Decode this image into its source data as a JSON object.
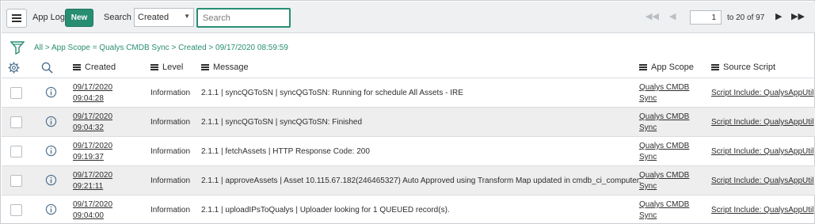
{
  "header": {
    "title": "App Log",
    "new_label": "New",
    "search_label": "Search",
    "search_field": "Created",
    "search_placeholder": "Search",
    "page_value": "1",
    "page_text": "to 20 of 97"
  },
  "breadcrumb": {
    "all": "All",
    "sep1": ">",
    "scope": "App Scope = Qualys CMDB Sync",
    "sep2": ">",
    "created": "Created > 09/17/2020 08:59:59"
  },
  "columns": {
    "created": "Created",
    "level": "Level",
    "message": "Message",
    "app_scope": "App Scope",
    "source_script": "Source Script"
  },
  "rows": [
    {
      "date": "09/17/2020",
      "time": "09:04:28",
      "level": "Information",
      "message": "2.1.1 | syncQGToSN | syncQGToSN: Running for schedule All Assets - IRE",
      "scope1": "Qualys CMDB",
      "scope2": "Sync",
      "script": "Script Include: QualysAppUtil"
    },
    {
      "date": "09/17/2020",
      "time": "09:04:32",
      "level": "Information",
      "message": "2.1.1 | syncQGToSN | syncQGToSN: Finished",
      "scope1": "Qualys CMDB",
      "scope2": "Sync",
      "script": "Script Include: QualysAppUtil"
    },
    {
      "date": "09/17/2020",
      "time": "09:19:37",
      "level": "Information",
      "message": "2.1.1 | fetchAssets | HTTP Response Code: 200",
      "scope1": "Qualys CMDB",
      "scope2": "Sync",
      "script": "Script Include: QualysAppUtil"
    },
    {
      "date": "09/17/2020",
      "time": "09:21:11",
      "level": "Information",
      "message": "2.1.1 | approveAssets | Asset 10.115.67.182(246465327) Auto Approved using Transform Map updated in cmdb_ci_computer.",
      "scope1": "Qualys CMDB",
      "scope2": "Sync",
      "script": "Script Include: QualysAppUtil"
    },
    {
      "date": "09/17/2020",
      "time": "09:04:00",
      "level": "Information",
      "message": "2.1.1 | uploadIPsToQualys | Uploader looking for 1 QUEUED record(s).",
      "scope1": "Qualys CMDB",
      "scope2": "Sync",
      "script": "Script Include: QualysAppUtil"
    }
  ],
  "colors": {
    "accent": "#278e72",
    "header_bg": "#eef0f2",
    "alt_row": "#eeeeee"
  },
  "icons": [
    "hamburger-icon",
    "first-page-icon",
    "prev-page-icon",
    "next-page-icon",
    "last-page-icon",
    "filter-icon",
    "gear-icon",
    "search-icon",
    "info-icon"
  ]
}
